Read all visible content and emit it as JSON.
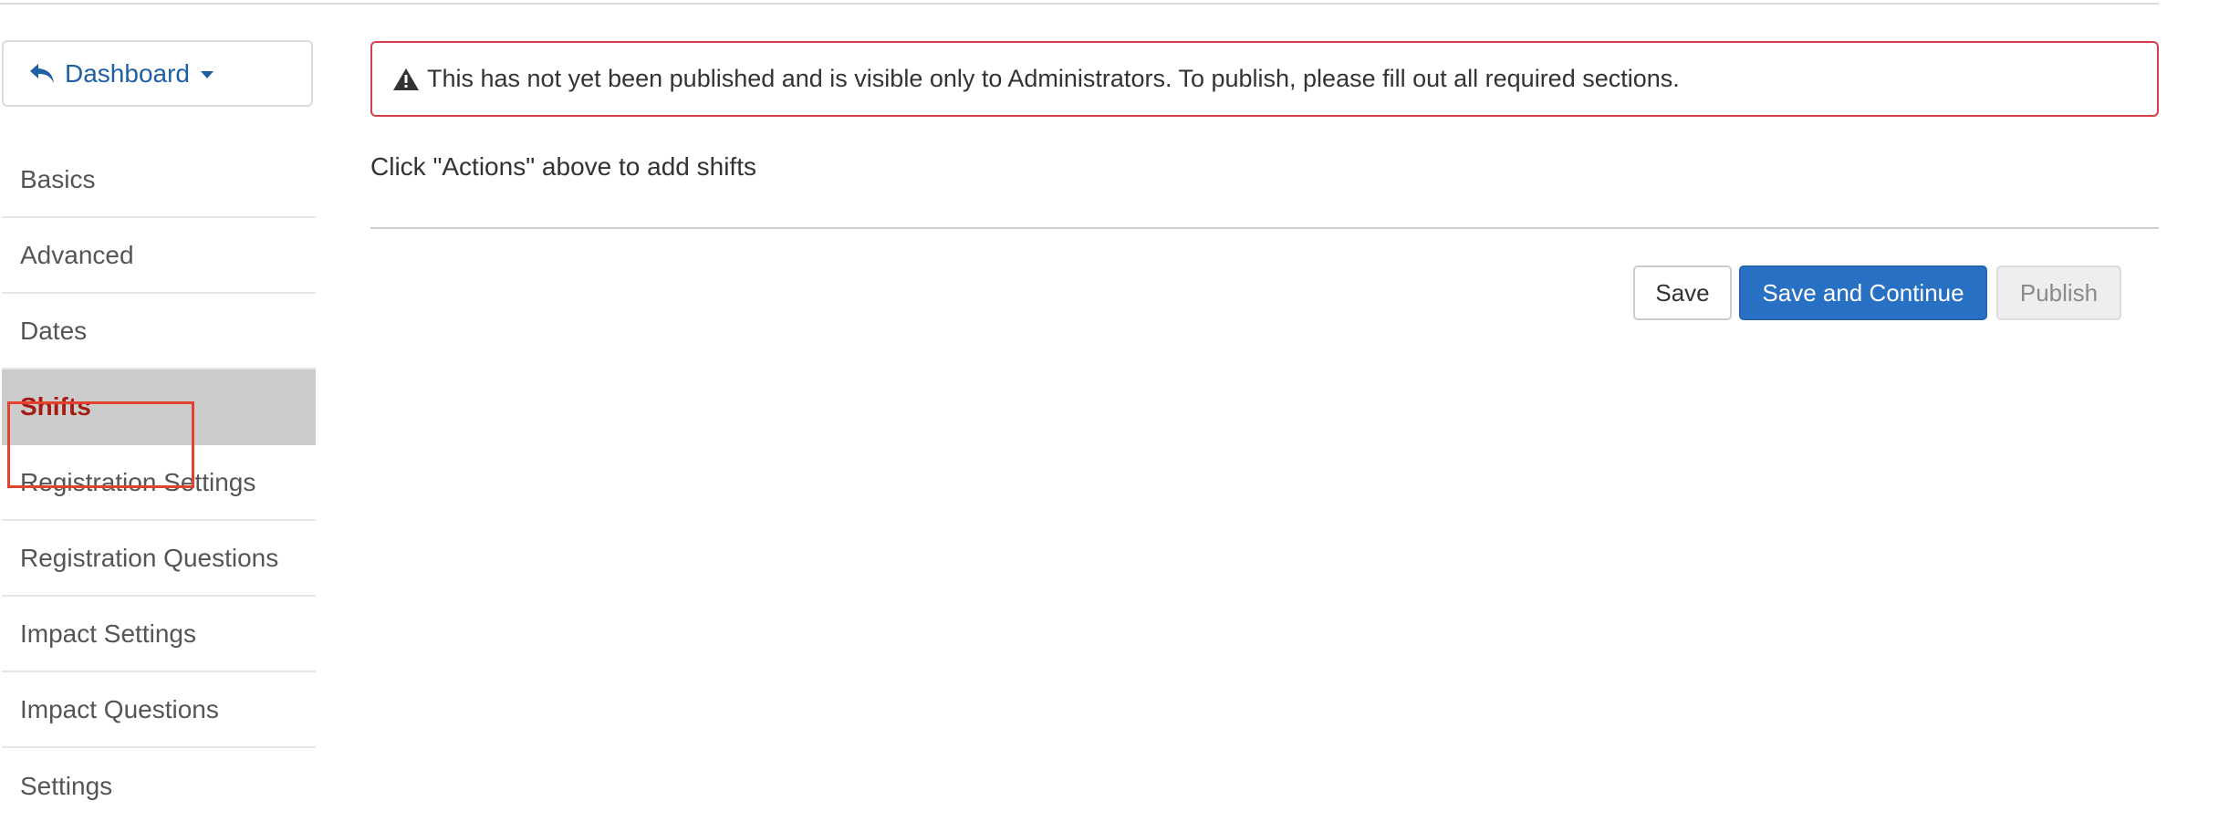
{
  "sidebar": {
    "dashboard_label": "Dashboard",
    "items": [
      {
        "label": "Basics"
      },
      {
        "label": "Advanced"
      },
      {
        "label": "Dates"
      },
      {
        "label": "Shifts"
      },
      {
        "label": "Registration Settings"
      },
      {
        "label": "Registration Questions"
      },
      {
        "label": "Impact Settings"
      },
      {
        "label": "Impact Questions"
      },
      {
        "label": "Settings"
      }
    ],
    "active_item": "Shifts"
  },
  "alert": {
    "icon": "warning-icon",
    "message": "This has not yet been published and is visible only to Administrators. To publish, please fill out all required sections."
  },
  "main": {
    "hint": "Click \"Actions\" above to add shifts"
  },
  "actions": {
    "save_label": "Save",
    "save_continue_label": "Save and Continue",
    "publish_label": "Publish"
  },
  "colors": {
    "link": "#1f5fa6",
    "active_text": "#a51d12",
    "alert_border": "#d4414d",
    "primary_button": "#2870c4",
    "highlight_box": "#e2412b"
  }
}
